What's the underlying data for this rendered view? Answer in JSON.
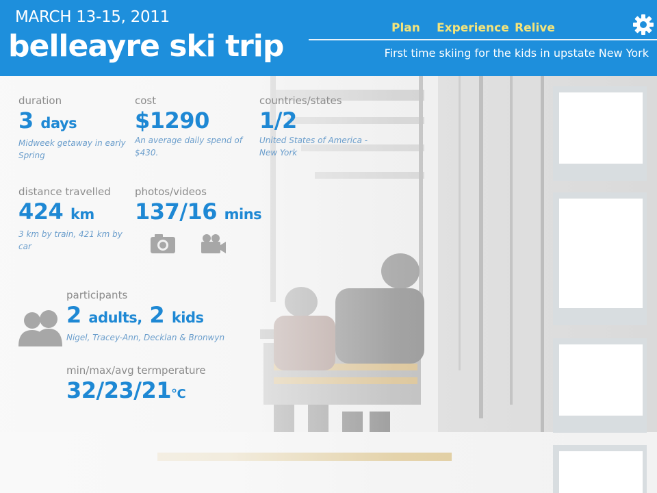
{
  "header": {
    "date": "MARCH 13-15, 2011",
    "title": "belleayre ski trip",
    "nav": [
      "Plan",
      "Experience",
      "Relive"
    ],
    "subtitle": "First time skiing for the kids in upstate New York"
  },
  "stats": {
    "duration": {
      "label": "duration",
      "value": "3",
      "unit": "days",
      "note": "Midweek getaway in early Spring"
    },
    "cost": {
      "label": "cost",
      "value": "$1290",
      "note": "An average daily spend of $430."
    },
    "countries": {
      "label": "countries/states",
      "value": "1/2",
      "note": "United States of America - New York"
    },
    "distance": {
      "label": "distance travelled",
      "value": "424",
      "unit": "km",
      "note": "3 km by train, 421 km by car"
    },
    "photos": {
      "label": "photos/videos",
      "value": "137/16",
      "unit": "mins"
    },
    "participants": {
      "label": "participants",
      "adults_count": "2",
      "adults_label": "adults,",
      "kids_count": "2",
      "kids_label": "kids",
      "note": "Nigel, Tracey-Ann, Decklan & Bronwyn"
    },
    "temperature": {
      "label": "min/max/avg termperature",
      "value": "32/23/21",
      "unit": "°C"
    }
  },
  "icons": {
    "settings": "gear-icon",
    "camera": "camera-icon",
    "video": "video-camera-icon",
    "people": "people-icon"
  },
  "colors": {
    "header": "#1e8fdc",
    "accent": "#1e88d4",
    "nav": "#f4e47a"
  }
}
